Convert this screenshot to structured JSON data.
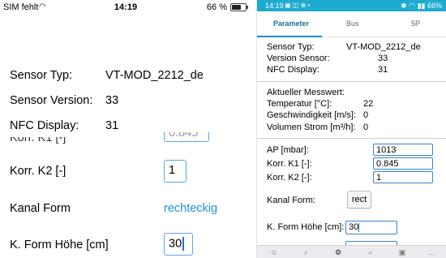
{
  "ios": {
    "status": {
      "carrier": "SIM fehlt",
      "time": "14:19",
      "battery": "66 %"
    },
    "sensor_typ_label": "Sensor Typ:",
    "sensor_typ_value": "VT-MOD_2212_de",
    "sensor_version_label": "Sensor Version:",
    "sensor_version_value": "33",
    "nfc_display_label": "NFC Display:",
    "nfc_display_value": "31",
    "korr_k1_label": "Korr. K1 [-]",
    "korr_k1_value": "0.845",
    "korr_k2_label": "Korr. K2 [-]",
    "korr_k2_value": "1",
    "kanal_form_label": "Kanal Form",
    "kanal_form_value": "rechteckig",
    "k_form_hoehe_label": "K. Form Höhe [cm]",
    "k_form_hoehe_value": "30"
  },
  "android": {
    "status": {
      "time": "14:19",
      "battery": "66%"
    },
    "tabs": [
      {
        "label": "Parameter"
      },
      {
        "label": "Bus"
      },
      {
        "label": "5P"
      }
    ],
    "info": {
      "sensor_typ_label": "Sensor Typ:",
      "sensor_typ_value": "VT-MOD_2212_de",
      "version_sensor_label": "Version Sensor:",
      "version_sensor_value": "33",
      "nfc_display_label": "NFC Display:",
      "nfc_display_value": "31"
    },
    "measurement": {
      "title": "Aktueller Messwert:",
      "temperatur_label": "Temperatur [°C]:",
      "temperatur_value": "22",
      "geschwindigkeit_label": "Geschwindigkeit [m/s]:",
      "geschwindigkeit_value": "0",
      "volumen_label": "Volumen Strom [m³/h]:",
      "volumen_value": "0"
    },
    "params": {
      "ap_label": "AP [mbar]:",
      "ap_value": "1013",
      "korr_k1_label": "Korr. K1 [-]:",
      "korr_k1_value": "0.845",
      "korr_k2_label": "Korr. K2 [-]:",
      "korr_k2_value": "1",
      "kanal_form_label": "Kanal Form:",
      "kanal_form_button": "rect",
      "k_form_hoehe_label": "K. Form Höhe [cm]:",
      "k_form_hoehe_value": "30"
    },
    "bottom_nav_icons": [
      "smiley-icon",
      "microphone-icon",
      "gear-icon",
      "search-icon",
      "sticker-icon",
      "more-icon"
    ]
  },
  "colors": {
    "ios_link": "#1e8fe0",
    "ios_field_border": "#5aa6ea",
    "android_statusbar": "#1eabd0",
    "android_tab_active": "#1a6e9a",
    "android_field_border": "#3a82c9"
  }
}
